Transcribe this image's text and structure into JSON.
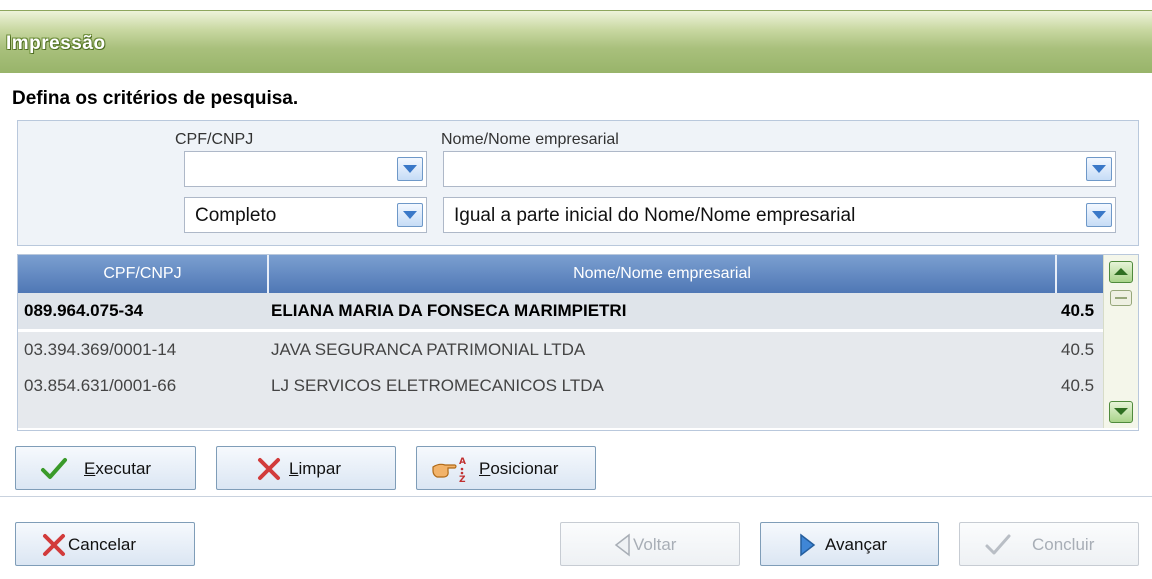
{
  "window": {
    "title": "Impressão"
  },
  "heading": "Defina os critérios de pesquisa.",
  "criteria": {
    "cpf_label": "CPF/CNPJ",
    "nome_label": "Nome/Nome empresarial",
    "cpf_value": "",
    "nome_value": "",
    "cpf_mode": "Completo",
    "nome_mode": "Igual a parte inicial do Nome/Nome empresarial"
  },
  "grid": {
    "columns": [
      "CPF/CNPJ",
      "Nome/Nome empresarial"
    ],
    "rows": [
      {
        "cpf": "089.964.075-34",
        "nome": "ELIANA MARIA DA FONSECA MARIMPIETRI",
        "extra": "40.5",
        "selected": true
      },
      {
        "cpf": "03.394.369/0001-14",
        "nome": "JAVA SEGURANCA PATRIMONIAL LTDA",
        "extra": "40.5",
        "selected": false
      },
      {
        "cpf": "03.854.631/0001-66",
        "nome": "LJ SERVICOS ELETROMECANICOS LTDA",
        "extra": "40.5",
        "selected": false
      }
    ]
  },
  "actions": {
    "executar": {
      "first": "E",
      "rest": "xecutar"
    },
    "limpar": {
      "first": "L",
      "rest": "impar"
    },
    "posicionar": {
      "first": "P",
      "rest": "osicionar"
    }
  },
  "footer": {
    "cancelar": "Cancelar",
    "voltar": "Voltar",
    "avancar": "Avançar",
    "concluir": "Concluir"
  },
  "colors": {
    "header_blue": "#5a80bc",
    "title_green": "#a9c07c",
    "selected_row": "#dfe4ea",
    "alt_row": "#e6e9ed"
  }
}
